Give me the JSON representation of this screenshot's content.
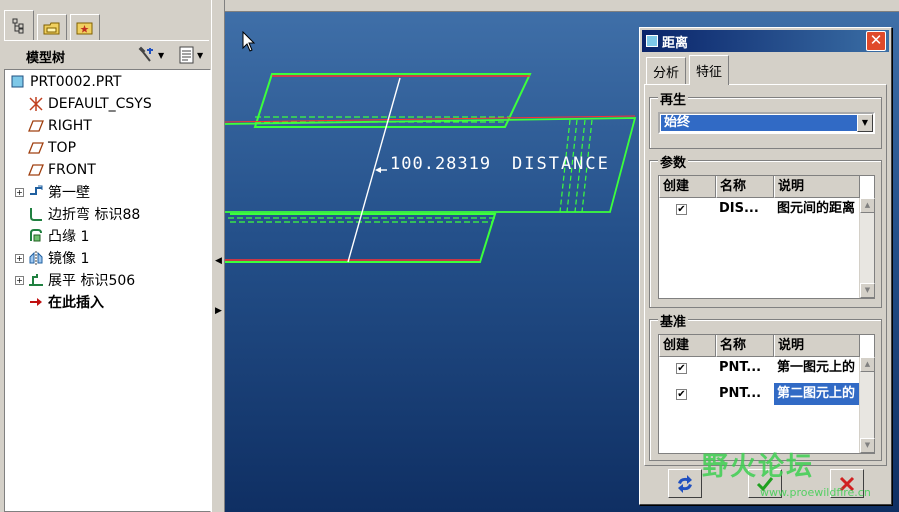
{
  "model_tree": {
    "title": "模型树",
    "items": [
      {
        "label": "PRT0002.PRT",
        "icon": "part-icon",
        "level": 0
      },
      {
        "label": "DEFAULT_CSYS",
        "icon": "csys-icon",
        "level": 1
      },
      {
        "label": "RIGHT",
        "icon": "datum-plane-icon",
        "level": 1
      },
      {
        "label": "TOP",
        "icon": "datum-plane-icon",
        "level": 1
      },
      {
        "label": "FRONT",
        "icon": "datum-plane-icon",
        "level": 1
      },
      {
        "label": "第一壁",
        "icon": "first-wall-icon",
        "level": 1,
        "expandable": true
      },
      {
        "label": "边折弯 标识88",
        "icon": "edge-bend-icon",
        "level": 1
      },
      {
        "label": "凸缘 1",
        "icon": "flange-icon",
        "level": 1
      },
      {
        "label": "镜像 1",
        "icon": "mirror-icon",
        "level": 1,
        "expandable": true
      },
      {
        "label": "展平 标识506",
        "icon": "unbend-icon",
        "level": 1,
        "expandable": true
      },
      {
        "label": "在此插入",
        "icon": "insert-here-arrow-icon",
        "level": 1
      }
    ]
  },
  "viewport": {
    "dimension_value": "100.28319",
    "dimension_label": "DISTANCE"
  },
  "dialog": {
    "title": "距离",
    "tabs": [
      "分析",
      "特征"
    ],
    "active_tab": "特征",
    "regenerate": {
      "label": "再生",
      "value": "始终"
    },
    "parameters": {
      "label": "参数",
      "columns": [
        "创建",
        "名称",
        "说明"
      ],
      "rows": [
        {
          "checked": true,
          "name": "DIS...",
          "desc": "图元间的距离"
        }
      ]
    },
    "datums": {
      "label": "基准",
      "columns": [
        "创建",
        "名称",
        "说明"
      ],
      "rows": [
        {
          "checked": true,
          "name": "PNT...",
          "desc": "第一图元上的",
          "selected": false
        },
        {
          "checked": true,
          "name": "PNT...",
          "desc": "第二图元上的",
          "selected": true
        }
      ]
    }
  },
  "watermark": {
    "text": "野火论坛",
    "url": "www.proewildfire.cn"
  },
  "colors": {
    "viewport_top": "#3f6fa8",
    "viewport_bottom": "#0f2f63",
    "edge_green": "#3cff3c",
    "edge_red": "#ff3030",
    "selection": "#316ac5"
  }
}
